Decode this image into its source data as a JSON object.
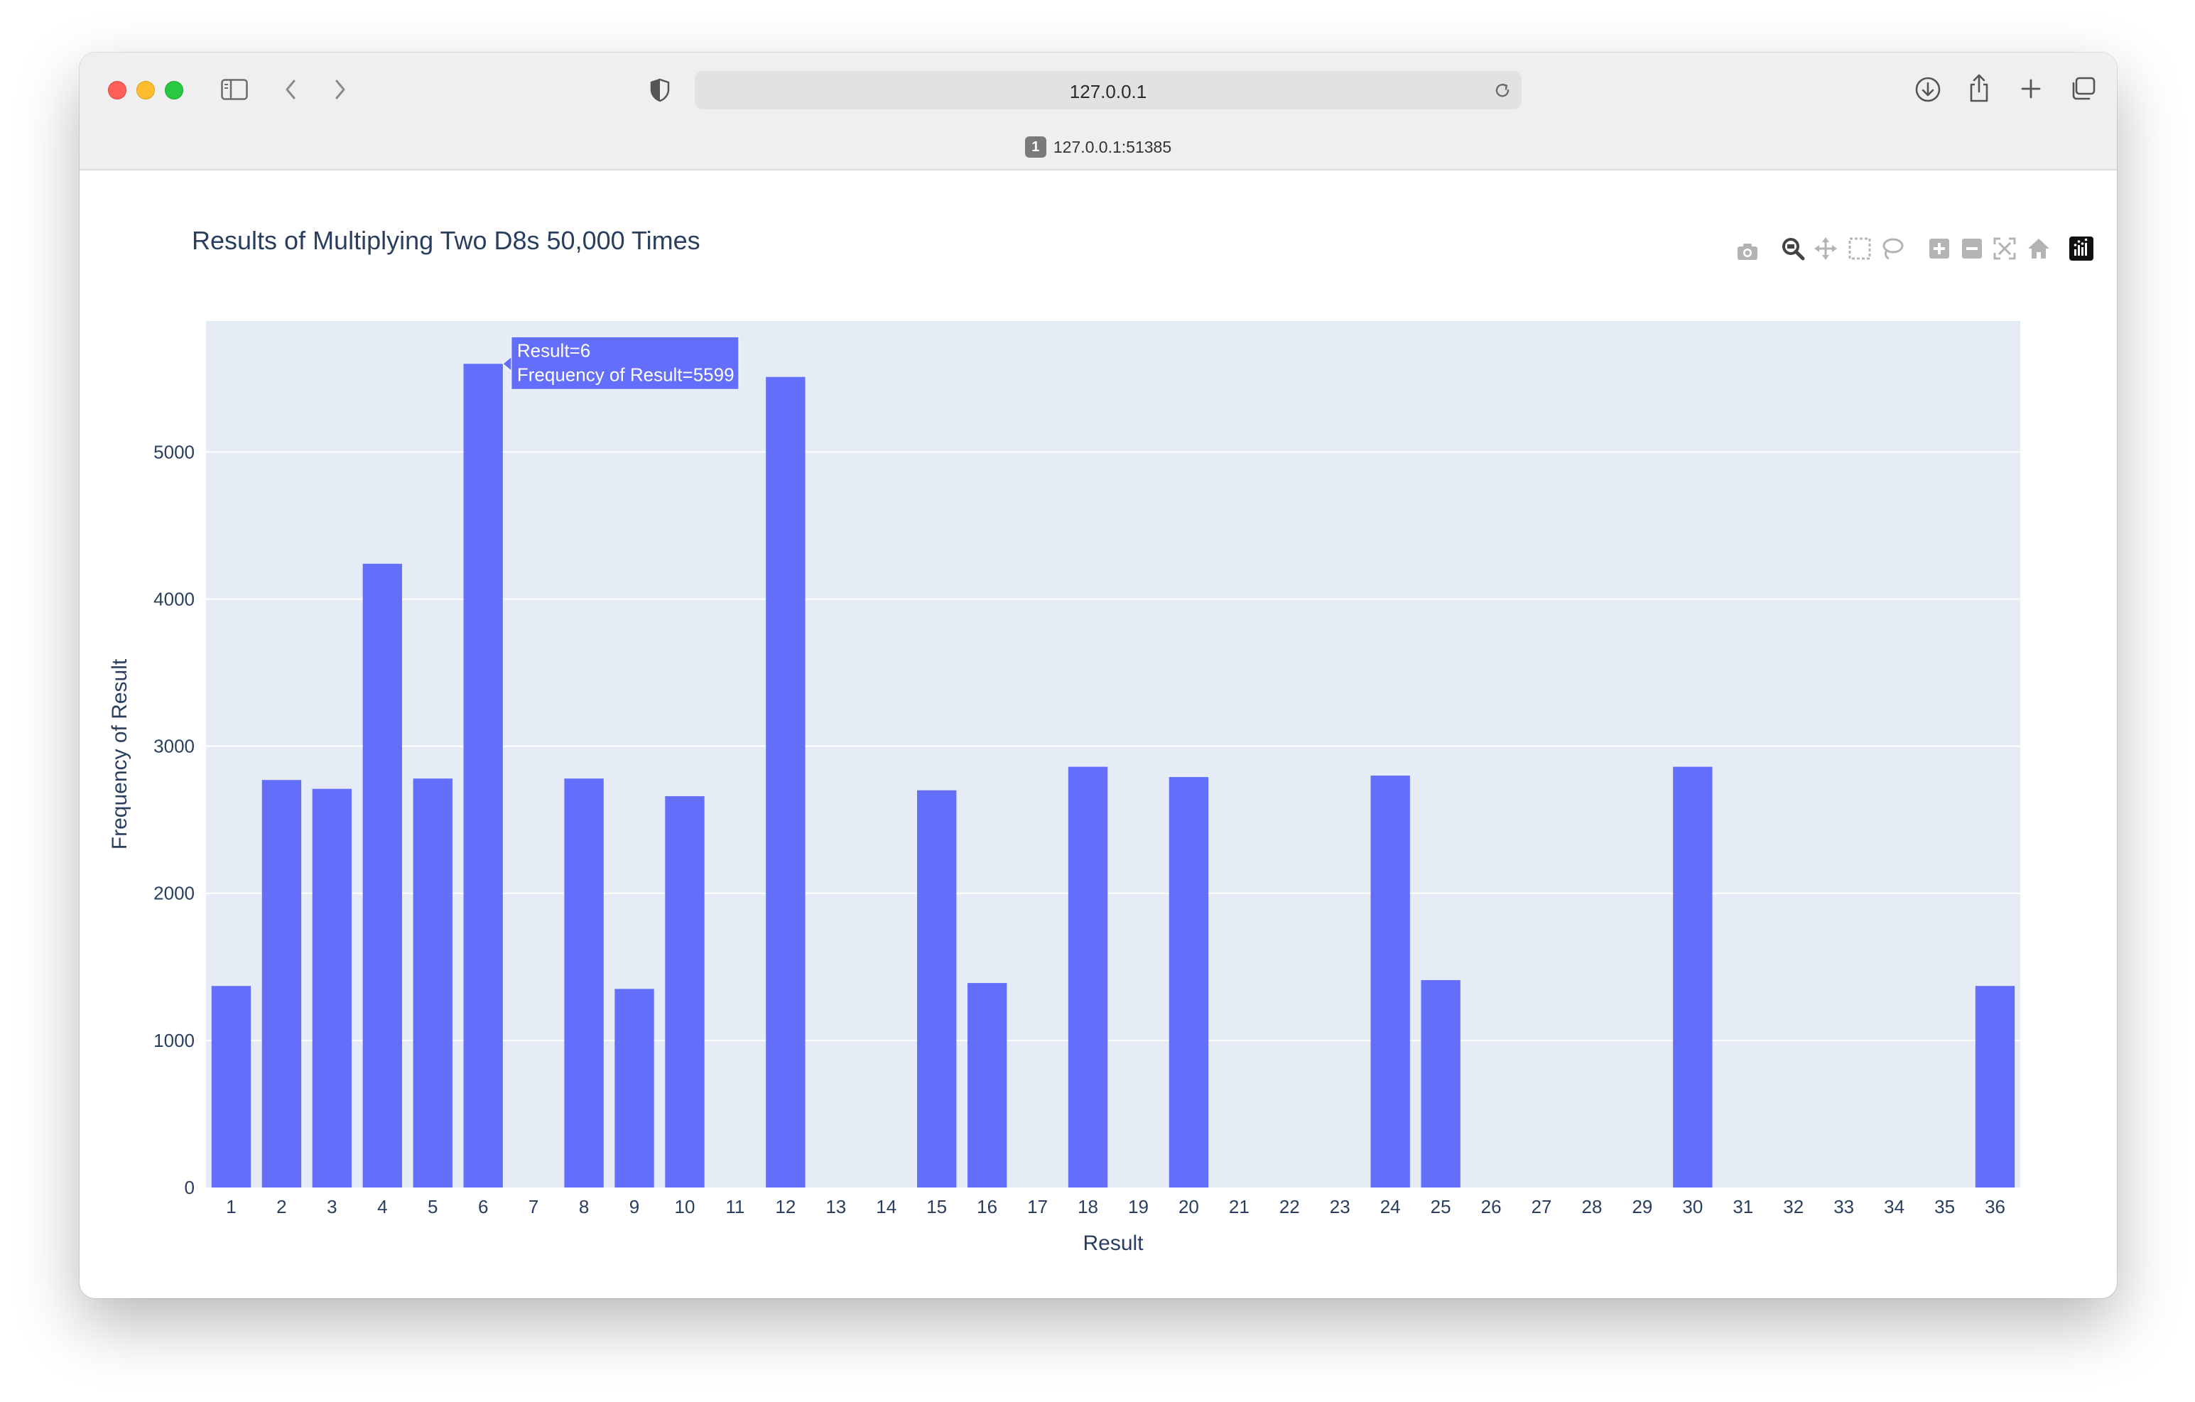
{
  "browser": {
    "address": "127.0.0.1",
    "tab_number": "1",
    "tab_title": "127.0.0.1:51385"
  },
  "modebar": {
    "icons": [
      "camera-icon",
      "zoom-icon",
      "pan-icon",
      "box-select-icon",
      "lasso-select-icon",
      "zoom-in-icon",
      "zoom-out-icon",
      "autoscale-icon",
      "reset-axes-icon",
      "plotly-logo-icon"
    ]
  },
  "colors": {
    "bar": "#636efa",
    "plot_bg": "#e5ecf6",
    "text": "#2a3f5f",
    "grid": "#ffffff"
  },
  "chart_data": {
    "type": "bar",
    "title": "Results of Multiplying Two D8s 50,000 Times",
    "xlabel": "Result",
    "ylabel": "Frequency of Result",
    "categories": [
      "1",
      "2",
      "3",
      "4",
      "5",
      "6",
      "7",
      "8",
      "9",
      "10",
      "11",
      "12",
      "13",
      "14",
      "15",
      "16",
      "17",
      "18",
      "19",
      "20",
      "21",
      "22",
      "23",
      "24",
      "25",
      "26",
      "27",
      "28",
      "29",
      "30",
      "31",
      "32",
      "33",
      "34",
      "35",
      "36"
    ],
    "values": [
      1370,
      2770,
      2710,
      4240,
      2780,
      5599,
      0,
      2780,
      1350,
      2660,
      0,
      5510,
      0,
      0,
      2700,
      1390,
      0,
      2860,
      0,
      2790,
      0,
      0,
      0,
      2800,
      1410,
      0,
      0,
      0,
      0,
      2860,
      0,
      0,
      0,
      0,
      0,
      1370
    ],
    "yticks": [
      "0",
      "1000",
      "2000",
      "3000",
      "4000",
      "5000"
    ],
    "ylim": [
      0,
      5890
    ],
    "grid": true,
    "legend": "none",
    "tooltip": {
      "line1": "Result=6",
      "line2": "Frequency of Result=5599"
    }
  }
}
